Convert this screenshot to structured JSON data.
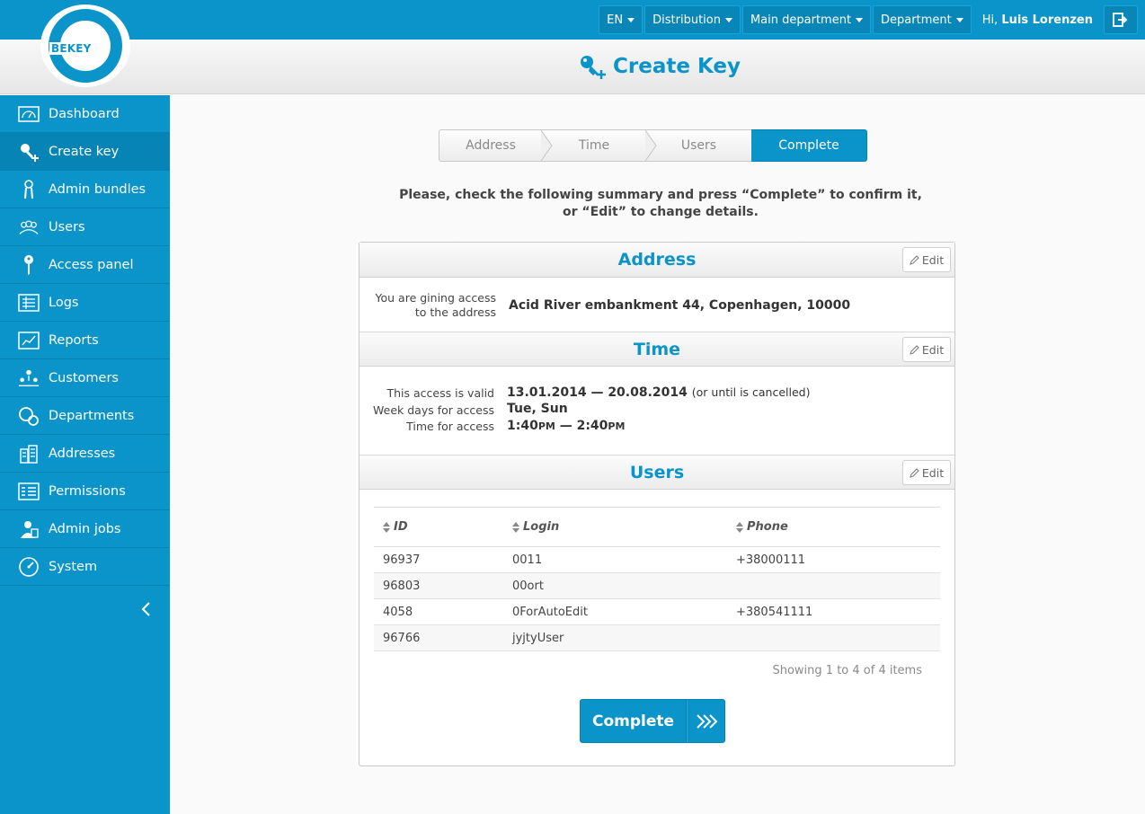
{
  "logo": {
    "text": "BEKEY"
  },
  "topbar": {
    "language": "EN",
    "distribution": "Distribution",
    "main_department": "Main department",
    "department": "Department",
    "greeting": "Hi,",
    "user_name": "Luis Lorenzen"
  },
  "page": {
    "title": "Create Key"
  },
  "sidebar": {
    "items": [
      {
        "label": "Dashboard",
        "icon": "dashboard-icon"
      },
      {
        "label": "Create key",
        "icon": "key-plus-icon",
        "active": true
      },
      {
        "label": "Admin bundles",
        "icon": "key-bundle-icon"
      },
      {
        "label": "Users",
        "icon": "users-icon"
      },
      {
        "label": "Access panel",
        "icon": "key-icon"
      },
      {
        "label": "Logs",
        "icon": "logs-icon"
      },
      {
        "label": "Reports",
        "icon": "reports-icon"
      },
      {
        "label": "Customers",
        "icon": "customers-icon"
      },
      {
        "label": "Departments",
        "icon": "departments-icon"
      },
      {
        "label": "Addresses",
        "icon": "addresses-icon"
      },
      {
        "label": "Permissions",
        "icon": "permissions-icon"
      },
      {
        "label": "Admin jobs",
        "icon": "admin-jobs-icon"
      },
      {
        "label": "System",
        "icon": "system-icon"
      }
    ]
  },
  "wizard": {
    "steps": [
      "Address",
      "Time",
      "Users",
      "Complete"
    ],
    "current": "Complete"
  },
  "intro": {
    "line1": "Please, check the following summary and press “Complete” to confirm it,",
    "line2": "or “Edit” to change details."
  },
  "address_section": {
    "title": "Address",
    "edit_label": "Edit",
    "label_line1": "You are gining access",
    "label_line2": "to the address",
    "value": "Acid River embankment 44, Copenhagen, 10000"
  },
  "time_section": {
    "title": "Time",
    "edit_label": "Edit",
    "valid_label": "This access is valid",
    "valid_value": "13.01.2014 — 20.08.2014",
    "valid_note": "(or until is cancelled)",
    "weekdays_label": "Week days for access",
    "weekdays_value": "Tue, Sun",
    "time_label": "Time for access",
    "time_start": "1:40",
    "time_start_suffix": "PM",
    "time_sep": "—",
    "time_end": "2:40",
    "time_end_suffix": "PM"
  },
  "users_section": {
    "title": "Users",
    "edit_label": "Edit",
    "columns": [
      "ID",
      "Login",
      "Phone"
    ],
    "rows": [
      {
        "id": "96937",
        "login": "0011",
        "phone": "+38000111"
      },
      {
        "id": "96803",
        "login": "00ort",
        "phone": ""
      },
      {
        "id": "4058",
        "login": "0ForAutoEdit",
        "phone": "+380541111"
      },
      {
        "id": "96766",
        "login": "jyjtyUser",
        "phone": ""
      }
    ],
    "showing": "Showing 1 to 4 of 4 items"
  },
  "complete_button": {
    "label": "Complete"
  },
  "colors": {
    "brand": "#0a94c9",
    "brand_dark": "#0783b4"
  }
}
